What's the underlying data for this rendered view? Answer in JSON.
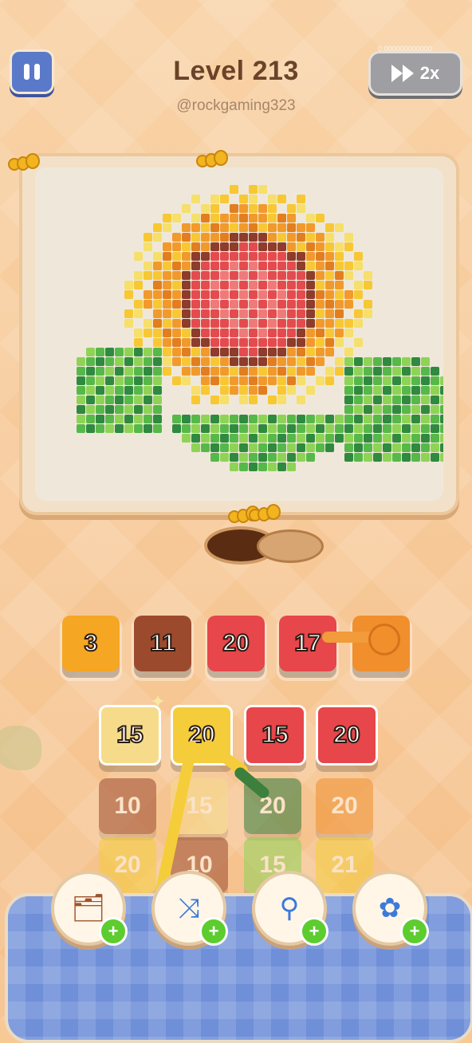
{
  "header": {
    "level_title": "Level 213",
    "handle": "@rockgaming323",
    "speed_label": "2x",
    "speed_top_text": "0.000000000000"
  },
  "icons": {
    "pause": "pause-icon",
    "fast_forward": "fast-forward-icon",
    "ant": "ant-icon",
    "hole": "hole-icon"
  },
  "puzzle": {
    "subject": "sunflower",
    "colors": {
      "pale_yellow": "#f6df6a",
      "yellow": "#f7c833",
      "orange": "#f19a2b",
      "dark_orange": "#e27e1f",
      "red": "#e44b4f",
      "pink": "#f07a7a",
      "brown": "#8e3c2b",
      "green": "#57b84a",
      "light_green": "#8fd356",
      "dark_green": "#2f8a3f"
    }
  },
  "queue_row": [
    {
      "value": "3",
      "color": "#f5a623"
    },
    {
      "value": "11",
      "color": "#9c4a2e"
    },
    {
      "value": "20",
      "color": "#e7464b"
    },
    {
      "value": "17",
      "color": "#e7464b"
    },
    {
      "value": "",
      "color": "#f08f2c"
    }
  ],
  "grid_rows": [
    [
      {
        "value": "15",
        "color": "#f6dc8a",
        "faded": false
      },
      {
        "value": "20",
        "color": "#f5cd3a",
        "faded": false
      },
      {
        "value": "15",
        "color": "#e7464b",
        "faded": false
      },
      {
        "value": "20",
        "color": "#e7464b",
        "faded": false
      }
    ],
    [
      {
        "value": "10",
        "color": "#9c4a2e",
        "faded": true
      },
      {
        "value": "15",
        "color": "#f6dc8a",
        "faded": true
      },
      {
        "value": "20",
        "color": "#2f7a3a",
        "faded": true
      },
      {
        "value": "20",
        "color": "#f08f2c",
        "faded": true
      }
    ],
    [
      {
        "value": "20",
        "color": "#f5cd3a",
        "faded": true
      },
      {
        "value": "10",
        "color": "#9c4a2e",
        "faded": true
      },
      {
        "value": "15",
        "color": "#8fd356",
        "faded": true
      },
      {
        "value": "21",
        "color": "#f5cd3a",
        "faded": true
      }
    ]
  ],
  "boosters": [
    {
      "name": "add-slot-booster",
      "icon": "cards-icon",
      "plus": "+"
    },
    {
      "name": "shuffle-booster",
      "icon": "shuffle-arrows-icon",
      "plus": "+"
    },
    {
      "name": "grabber-booster",
      "icon": "claw-magnet-icon",
      "plus": "+"
    },
    {
      "name": "swap-booster",
      "icon": "flower-button-icon",
      "plus": "+"
    }
  ]
}
